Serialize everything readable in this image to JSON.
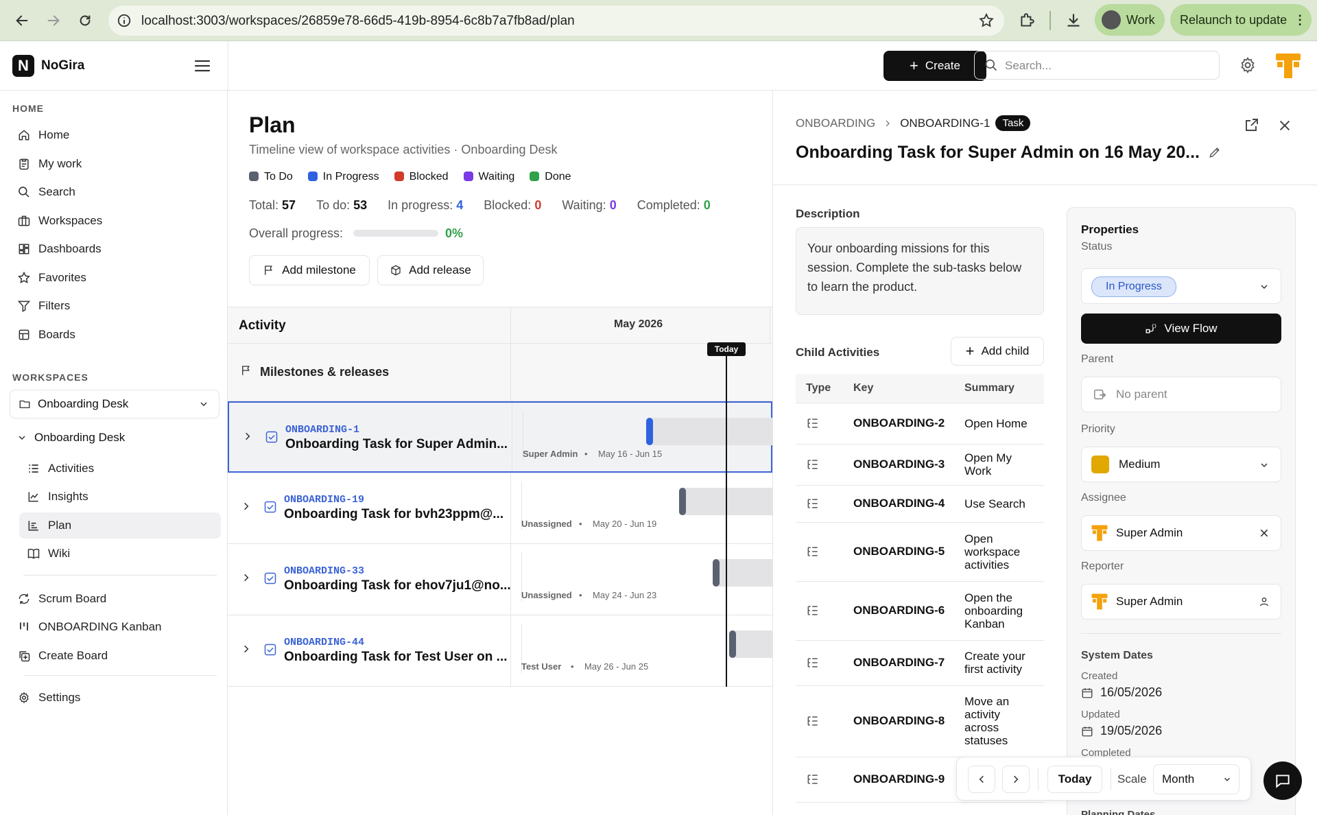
{
  "browser": {
    "url": "localhost:3003/workspaces/26859e78-66d5-419b-8954-6c8b7a7fb8ad/plan",
    "profile_label": "Work",
    "relaunch_label": "Relaunch to update"
  },
  "app": {
    "name": "NoGira",
    "create_label": "Create",
    "search_placeholder": "Search..."
  },
  "sidebar": {
    "home_section": "HOME",
    "home_items": [
      {
        "label": "Home",
        "icon": "home-icon"
      },
      {
        "label": "My work",
        "icon": "clipboard-icon"
      },
      {
        "label": "Search",
        "icon": "search-icon"
      },
      {
        "label": "Workspaces",
        "icon": "briefcase-icon"
      },
      {
        "label": "Dashboards",
        "icon": "dashboard-icon"
      },
      {
        "label": "Favorites",
        "icon": "star-icon"
      },
      {
        "label": "Filters",
        "icon": "filter-icon"
      },
      {
        "label": "Boards",
        "icon": "board-icon"
      }
    ],
    "workspaces_section": "WORKSPACES",
    "workspace_selected": "Onboarding Desk",
    "workspace_tree_label": "Onboarding Desk",
    "workspace_items": [
      {
        "label": "Activities",
        "icon": "list-icon"
      },
      {
        "label": "Insights",
        "icon": "chart-icon"
      },
      {
        "label": "Plan",
        "icon": "plan-icon",
        "active": true
      },
      {
        "label": "Wiki",
        "icon": "book-icon"
      }
    ],
    "board_items": [
      {
        "label": "Scrum Board",
        "icon": "scrum-icon"
      },
      {
        "label": "ONBOARDING Kanban",
        "icon": "kanban-icon"
      },
      {
        "label": "Create Board",
        "icon": "create-board-icon"
      }
    ],
    "settings_label": "Settings"
  },
  "plan": {
    "title": "Plan",
    "subtitle": "Timeline view of workspace activities · Onboarding Desk",
    "legend": [
      {
        "label": "To Do",
        "color": "#5b6170"
      },
      {
        "label": "In Progress",
        "color": "#2f62e0"
      },
      {
        "label": "Blocked",
        "color": "#d23b2a"
      },
      {
        "label": "Waiting",
        "color": "#7a3be6"
      },
      {
        "label": "Done",
        "color": "#2fa14a"
      }
    ],
    "stats": {
      "total_label": "Total:",
      "total": "57",
      "todo_label": "To do:",
      "todo": "53",
      "inprogress_label": "In progress:",
      "inprogress": "4",
      "blocked_label": "Blocked:",
      "blocked": "0",
      "waiting_label": "Waiting:",
      "waiting": "0",
      "completed_label": "Completed:",
      "completed": "0"
    },
    "progress_label": "Overall progress:",
    "progress_value": "0%",
    "progress_fraction": 0,
    "add_milestone": "Add milestone",
    "add_release": "Add release",
    "activity_header": "Activity",
    "month_header": "May 2026",
    "today_label": "Today",
    "milestones_label": "Milestones & releases",
    "rows": [
      {
        "key": "ONBOARDING-1",
        "title": "Onboarding Task for Super Admin...",
        "assignee": "Super Admin",
        "dates": "May 16 - Jun 15",
        "bar_color": "#2f62e0"
      },
      {
        "key": "ONBOARDING-19",
        "title": "Onboarding Task for bvh23ppm@...",
        "assignee": "Unassigned",
        "dates": "May 20 - Jun 19",
        "bar_color": "#5b6170"
      },
      {
        "key": "ONBOARDING-33",
        "title": "Onboarding Task for ehov7ju1@no...",
        "assignee": "Unassigned",
        "dates": "May 24 - Jun 23",
        "bar_color": "#5b6170"
      },
      {
        "key": "ONBOARDING-44",
        "title": "Onboarding Task for Test User on ...",
        "assignee": "Test User",
        "dates": "May 26 - Jun 25",
        "bar_color": "#5b6170"
      }
    ]
  },
  "detail": {
    "breadcrumb_project": "ONBOARDING",
    "breadcrumb_key": "ONBOARDING-1",
    "type_badge": "Task",
    "title": "Onboarding Task for Super Admin on 16 May 20...",
    "description_label": "Description",
    "description": "Your onboarding missions for this session. Complete the sub-tasks below to learn the product.",
    "child_label": "Child Activities",
    "add_child": "Add child",
    "child_headers": {
      "type": "Type",
      "key": "Key",
      "summary": "Summary"
    },
    "children": [
      {
        "key": "ONBOARDING-2",
        "summary": "Open Home"
      },
      {
        "key": "ONBOARDING-3",
        "summary": "Open My Work"
      },
      {
        "key": "ONBOARDING-4",
        "summary": "Use Search"
      },
      {
        "key": "ONBOARDING-5",
        "summary": "Open workspace activities"
      },
      {
        "key": "ONBOARDING-6",
        "summary": "Open the onboarding Kanban"
      },
      {
        "key": "ONBOARDING-7",
        "summary": "Create your first activity"
      },
      {
        "key": "ONBOARDING-8",
        "summary": "Move an activity across statuses"
      },
      {
        "key": "ONBOARDING-9",
        "summary": ""
      }
    ],
    "properties_label": "Properties",
    "status_label": "Status",
    "status_value": "In Progress",
    "view_flow": "View Flow",
    "parent_label": "Parent",
    "parent_value": "No parent",
    "priority_label": "Priority",
    "priority_value": "Medium",
    "priority_color": "#e0a800",
    "assignee_label": "Assignee",
    "assignee_value": "Super Admin",
    "reporter_label": "Reporter",
    "reporter_value": "Super Admin",
    "system_dates_label": "System Dates",
    "created_label": "Created",
    "created_value": "16/05/2026",
    "updated_label": "Updated",
    "updated_value": "19/05/2026",
    "completed_label": "Completed",
    "planning_label": "Planning Dates"
  },
  "timeline_controls": {
    "today": "Today",
    "scale_label": "Scale",
    "scale_value": "Month"
  }
}
